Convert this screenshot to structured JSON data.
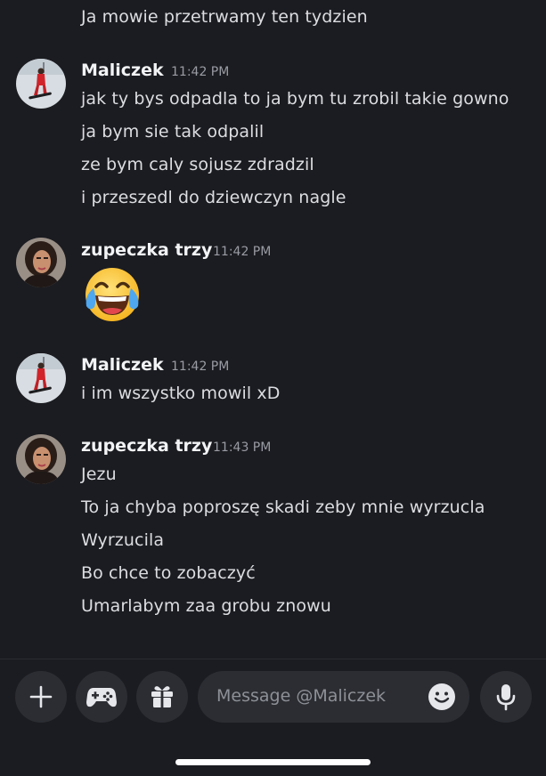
{
  "chat": {
    "top_message": "Ja mowie przetrwamy ten tydzien",
    "groups": [
      {
        "author": "Maliczek",
        "time": "11:42 PM",
        "avatar": "snowboarder-avatar",
        "lines": [
          "jak ty bys odpadla to ja bym tu zrobil takie gowno",
          "ja bym sie tak odpalil",
          "ze bym caly sojusz zdradzil",
          "i przeszedl do dziewczyn nagle"
        ]
      },
      {
        "author": "zupeczka trzy",
        "time": "11:42 PM",
        "avatar": "woman-portrait-avatar",
        "emoji": "face-with-tears-of-joy"
      },
      {
        "author": "Maliczek",
        "time": "11:42 PM",
        "avatar": "snowboarder-avatar",
        "lines": [
          "i im wszystko mowil xD"
        ]
      },
      {
        "author": "zupeczka trzy",
        "time": "11:43 PM",
        "avatar": "woman-portrait-avatar",
        "lines": [
          "Jezu",
          "To ja chyba poproszę skadi zeby mnie wyrzucla",
          "Wyrzucila",
          "Bo chce to zobaczyć",
          "Umarlabym zaa grobu znowu"
        ]
      }
    ]
  },
  "composer": {
    "placeholder": "Message @Maliczek",
    "buttons": [
      "plus-icon",
      "gamepad-icon",
      "gift-icon"
    ],
    "emoji_button": "smiley-icon",
    "voice_button": "microphone-icon"
  },
  "colors": {
    "background": "#1b1c21",
    "surface": "#2b2d33",
    "text": "#dcdde1",
    "muted": "#9a9ca4"
  }
}
